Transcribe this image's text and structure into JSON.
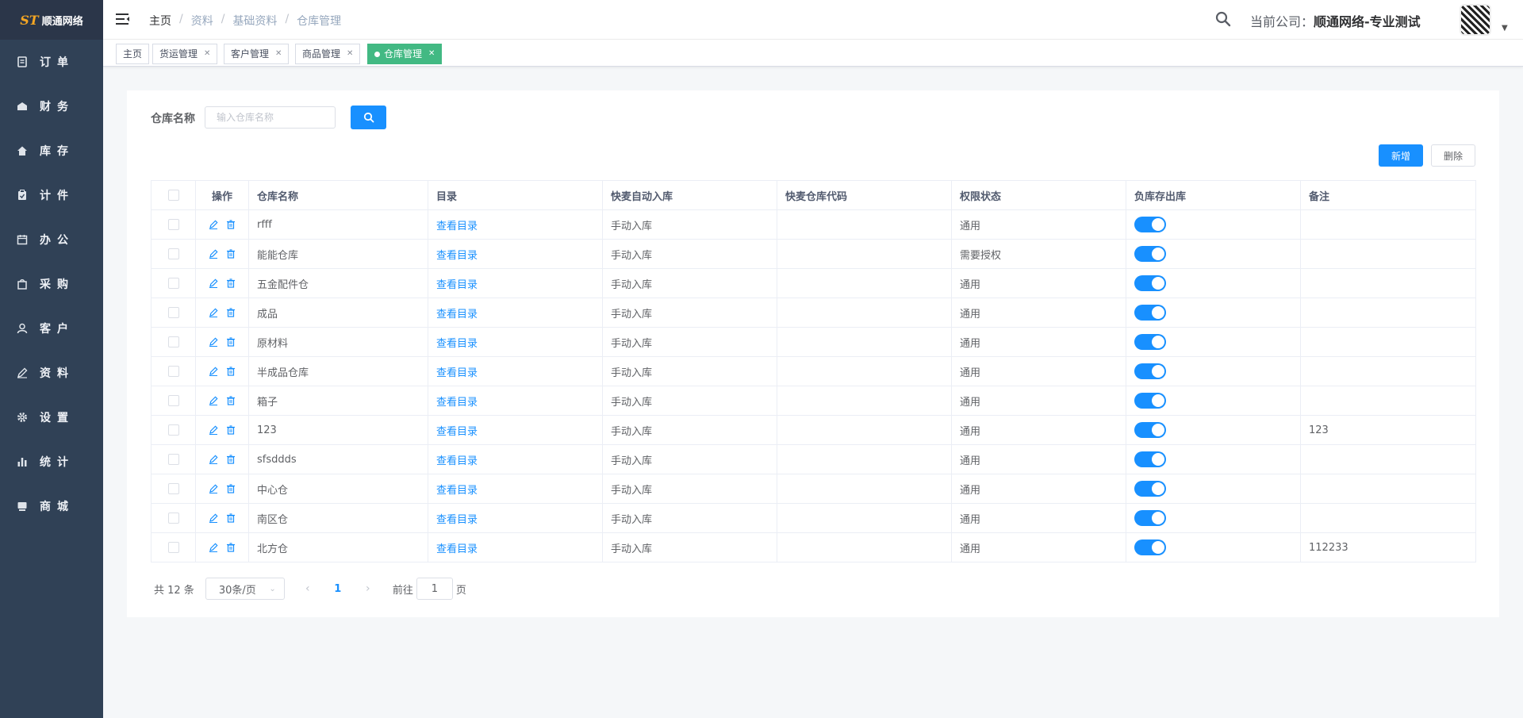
{
  "logo": {
    "mark": "ST",
    "text": "顺通网络"
  },
  "sidebar": {
    "items": [
      {
        "label": "订单",
        "icon": "order-icon"
      },
      {
        "label": "财务",
        "icon": "finance-icon"
      },
      {
        "label": "库存",
        "icon": "home-icon"
      },
      {
        "label": "计件",
        "icon": "clipboard-icon"
      },
      {
        "label": "办公",
        "icon": "calendar-icon"
      },
      {
        "label": "采购",
        "icon": "shopping-bag-icon"
      },
      {
        "label": "客户",
        "icon": "user-icon"
      },
      {
        "label": "资料",
        "icon": "edit-icon"
      },
      {
        "label": "设置",
        "icon": "gear-icon"
      },
      {
        "label": "统计",
        "icon": "bar-chart-icon"
      },
      {
        "label": "商城",
        "icon": "shop-icon"
      }
    ]
  },
  "header": {
    "breadcrumb": [
      "主页",
      "资料",
      "基础资料",
      "仓库管理"
    ],
    "company_label": "当前公司：",
    "company_name": "顺通网络-专业测试"
  },
  "tags": [
    {
      "label": "主页",
      "closable": false,
      "active": false
    },
    {
      "label": "货运管理",
      "closable": true,
      "active": false
    },
    {
      "label": "客户管理",
      "closable": true,
      "active": false
    },
    {
      "label": "商品管理",
      "closable": true,
      "active": false
    },
    {
      "label": "仓库管理",
      "closable": true,
      "active": true
    }
  ],
  "filter": {
    "label": "仓库名称",
    "placeholder": "输入仓库名称",
    "value": ""
  },
  "actions": {
    "add": "新增",
    "delete": "删除"
  },
  "table": {
    "headers": [
      "操作",
      "仓库名称",
      "目录",
      "快麦自动入库",
      "快麦仓库代码",
      "权限状态",
      "负库存出库",
      "备注"
    ],
    "rows": [
      {
        "name": "rfff",
        "catalog": "查看目录",
        "auto_in": "手动入库",
        "code": "",
        "perm": "通用",
        "negative": true,
        "remark": ""
      },
      {
        "name": "能能仓库",
        "catalog": "查看目录",
        "auto_in": "手动入库",
        "code": "",
        "perm": "需要授权",
        "negative": true,
        "remark": ""
      },
      {
        "name": "五金配件仓",
        "catalog": "查看目录",
        "auto_in": "手动入库",
        "code": "",
        "perm": "通用",
        "negative": true,
        "remark": ""
      },
      {
        "name": "成品",
        "catalog": "查看目录",
        "auto_in": "手动入库",
        "code": "",
        "perm": "通用",
        "negative": true,
        "remark": ""
      },
      {
        "name": "原材料",
        "catalog": "查看目录",
        "auto_in": "手动入库",
        "code": "",
        "perm": "通用",
        "negative": true,
        "remark": ""
      },
      {
        "name": "半成品仓库",
        "catalog": "查看目录",
        "auto_in": "手动入库",
        "code": "",
        "perm": "通用",
        "negative": true,
        "remark": ""
      },
      {
        "name": "箱子",
        "catalog": "查看目录",
        "auto_in": "手动入库",
        "code": "",
        "perm": "通用",
        "negative": true,
        "remark": ""
      },
      {
        "name": "123",
        "catalog": "查看目录",
        "auto_in": "手动入库",
        "code": "",
        "perm": "通用",
        "negative": true,
        "remark": "123"
      },
      {
        "name": "sfsddds",
        "catalog": "查看目录",
        "auto_in": "手动入库",
        "code": "",
        "perm": "通用",
        "negative": true,
        "remark": ""
      },
      {
        "name": "中心仓",
        "catalog": "查看目录",
        "auto_in": "手动入库",
        "code": "",
        "perm": "通用",
        "negative": true,
        "remark": ""
      },
      {
        "name": "南区仓",
        "catalog": "查看目录",
        "auto_in": "手动入库",
        "code": "",
        "perm": "通用",
        "negative": true,
        "remark": ""
      },
      {
        "name": "北方仓",
        "catalog": "查看目录",
        "auto_in": "手动入库",
        "code": "",
        "perm": "通用",
        "negative": true,
        "remark": "112233"
      }
    ]
  },
  "pagination": {
    "total": "共 12 条",
    "page_size": "30条/页",
    "current_page": "1",
    "goto_label": "前往",
    "goto_value": "1",
    "page_suffix": "页"
  },
  "colors": {
    "primary": "#1890ff",
    "active_tag": "#42b983",
    "sidebar": "#304156"
  }
}
